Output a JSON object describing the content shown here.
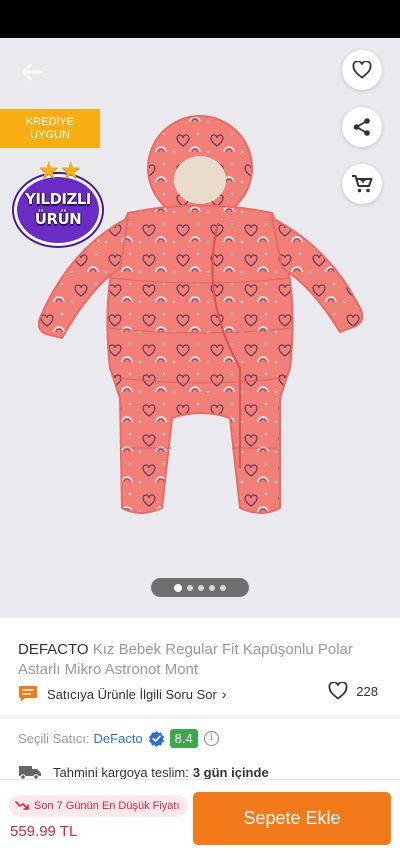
{
  "product": {
    "brand": "DEFACTO",
    "title": "Kız Bebek Regular Fit Kapüşonlu Polar Astarlı Mikro Astronot Mont"
  },
  "badges": {
    "credit_line1": "KREDİYE",
    "credit_line2": "UYGUN",
    "star_line1": "YILDIZLI",
    "star_line2": "ÜRÜN"
  },
  "gallery": {
    "image_count": 5,
    "active_index": 0
  },
  "question": {
    "label": "Satıcıya Ürünle İlgili Soru Sor",
    "chevron": "›"
  },
  "favorites": {
    "count": "228"
  },
  "seller": {
    "label": "Seçili Satıcı:",
    "name": "DeFacto",
    "score": "8.4",
    "info_glyph": "i"
  },
  "shipping": {
    "label": "Tahmini kargoya teslim:",
    "value": "3 gün içinde"
  },
  "bottom": {
    "lowest_label": "Son 7 Günün En Düşük Fiyatı",
    "price": "559.99 TL",
    "add_to_cart": "Sepete Ekle"
  },
  "icons": {
    "back": "arrow-left-icon",
    "favorite": "heart-icon",
    "share": "share-icon",
    "cart": "cart-icon",
    "question": "chat-bubble-icon",
    "verified": "verified-check-icon",
    "shipping": "truck-icon",
    "trend": "trend-down-icon"
  },
  "colors": {
    "accent": "#f27a1a",
    "price": "#d3263c",
    "seller_link": "#2e6ecf",
    "score_bg": "#3ea64c",
    "credit_bg": "#f8ae12",
    "star_badge": "#6a2cc4",
    "product": "#f27f78"
  }
}
